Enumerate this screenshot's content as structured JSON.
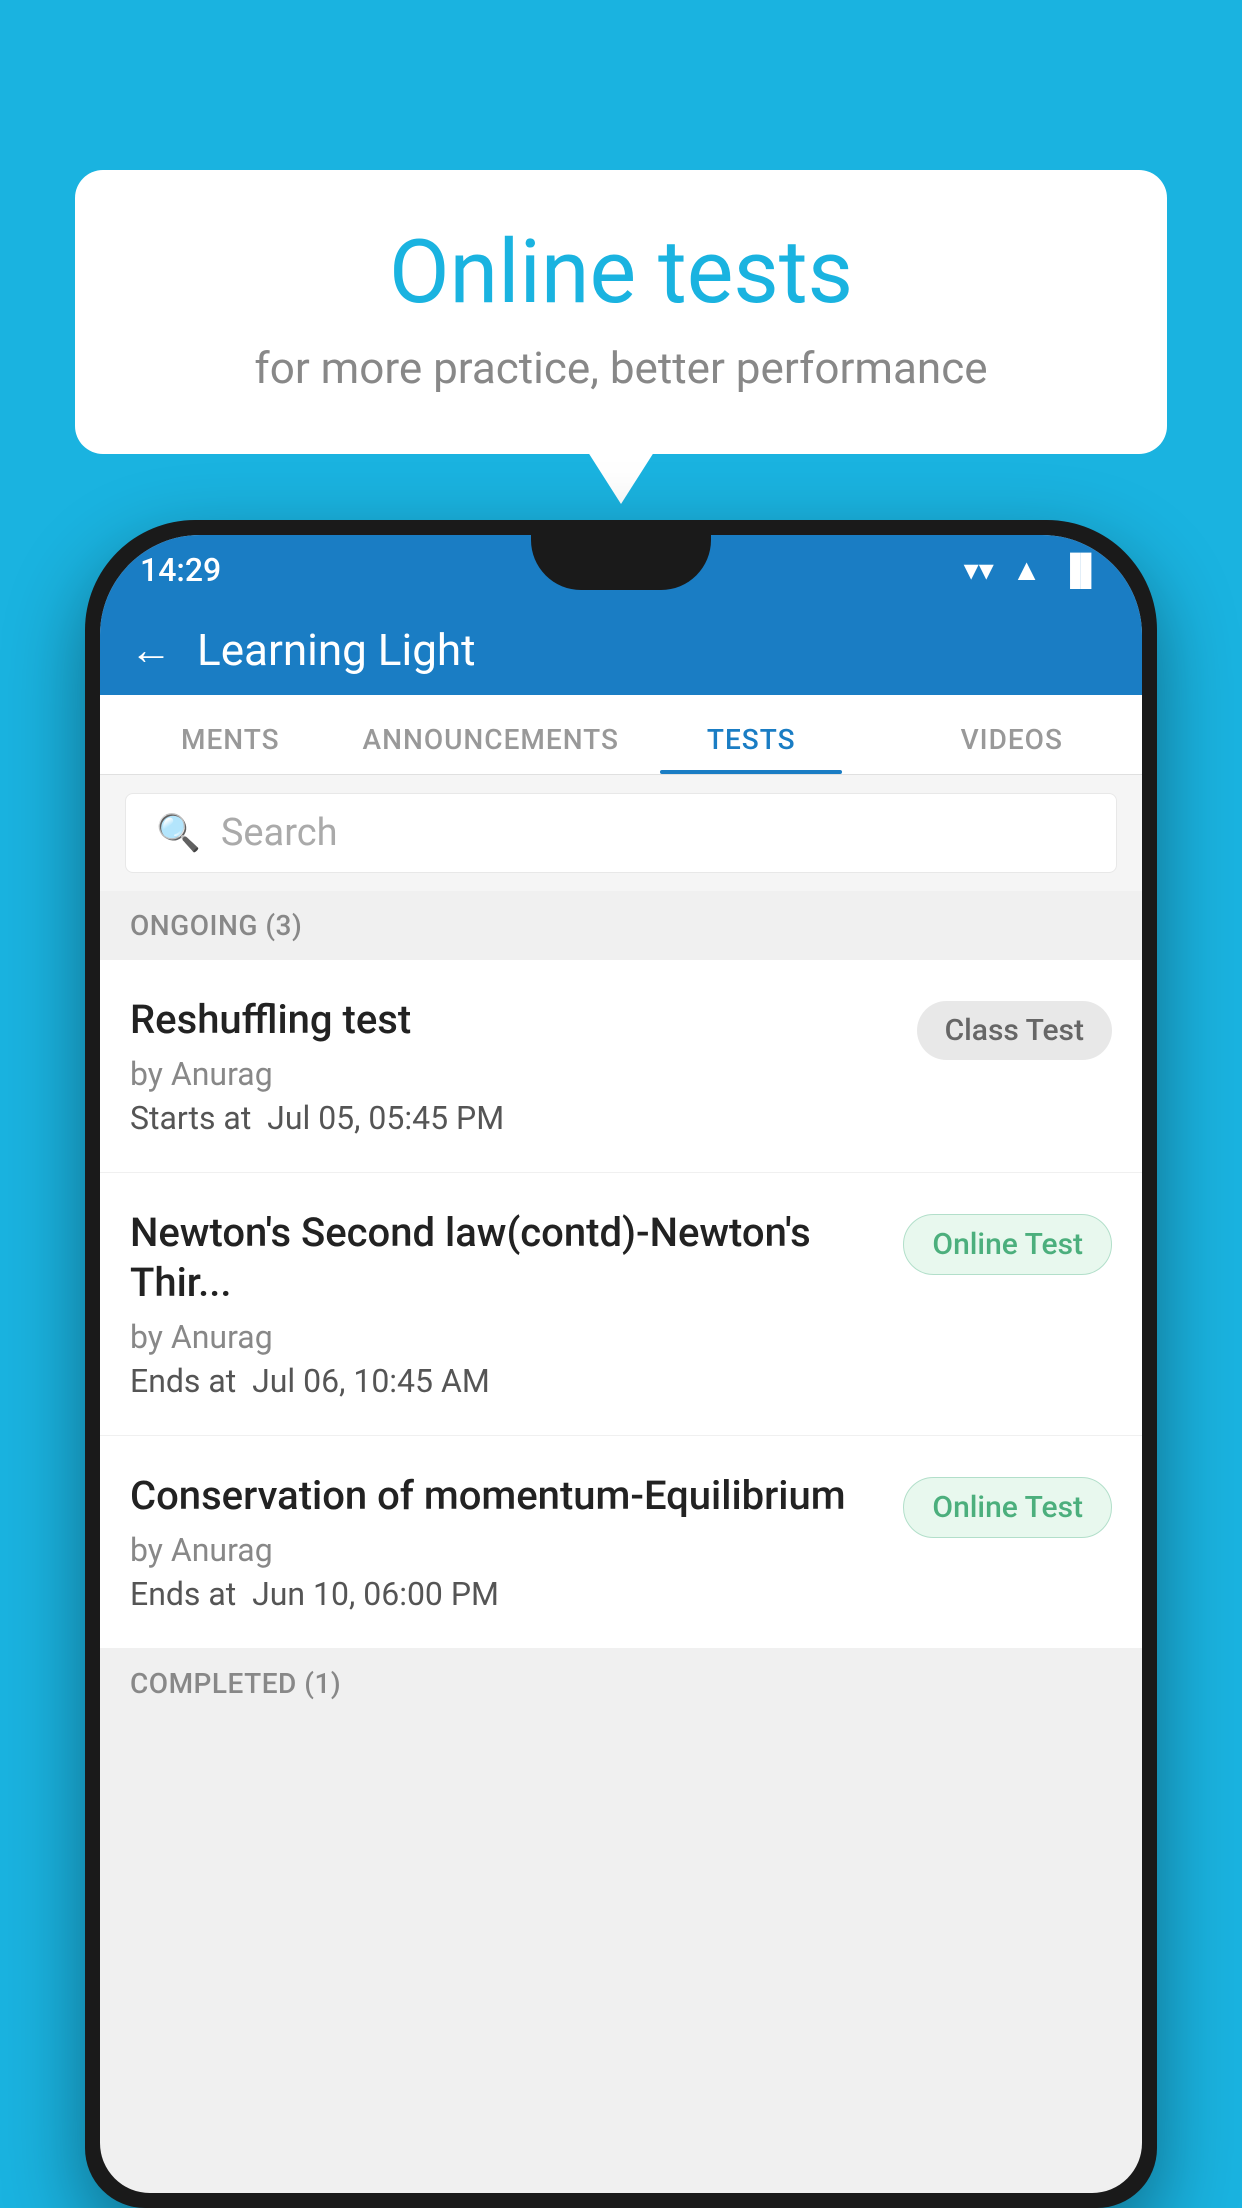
{
  "background": {
    "color": "#1ab3e0"
  },
  "bubble": {
    "title": "Online tests",
    "subtitle": "for more practice, better performance"
  },
  "status_bar": {
    "time": "14:29",
    "icons": {
      "wifi": "▼",
      "signal": "▲",
      "battery": "▐"
    }
  },
  "app_header": {
    "back_label": "←",
    "title": "Learning Light"
  },
  "tabs": [
    {
      "label": "MENTS",
      "active": false
    },
    {
      "label": "ANNOUNCEMENTS",
      "active": false
    },
    {
      "label": "TESTS",
      "active": true
    },
    {
      "label": "VIDEOS",
      "active": false
    }
  ],
  "search": {
    "placeholder": "Search"
  },
  "section_ongoing": {
    "label": "ONGOING (3)"
  },
  "tests": [
    {
      "name": "Reshuffling test",
      "by": "by Anurag",
      "time_label": "Starts at",
      "time_value": "Jul 05, 05:45 PM",
      "badge": "Class Test",
      "badge_type": "class"
    },
    {
      "name": "Newton's Second law(contd)-Newton's Thir...",
      "by": "by Anurag",
      "time_label": "Ends at",
      "time_value": "Jul 06, 10:45 AM",
      "badge": "Online Test",
      "badge_type": "online"
    },
    {
      "name": "Conservation of momentum-Equilibrium",
      "by": "by Anurag",
      "time_label": "Ends at",
      "time_value": "Jun 10, 06:00 PM",
      "badge": "Online Test",
      "badge_type": "online"
    }
  ],
  "section_completed": {
    "label": "COMPLETED (1)"
  }
}
